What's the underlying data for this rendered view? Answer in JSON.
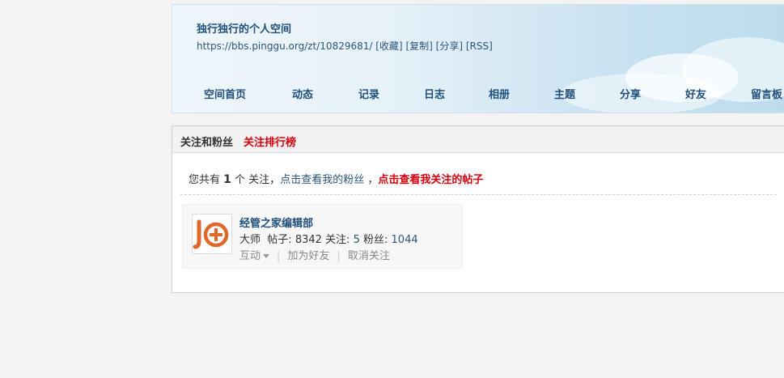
{
  "header": {
    "title": "独行独行的个人空间",
    "url": "https://bbs.pinggu.org/zt/10829681/",
    "links": [
      "[收藏]",
      "[复制]",
      "[分享]",
      "[RSS]"
    ]
  },
  "nav": [
    "空间首页",
    "动态",
    "记录",
    "日志",
    "相册",
    "主题",
    "分享",
    "好友",
    "留言板"
  ],
  "panel": {
    "title": "关注和粉丝",
    "rank_link": "关注排行榜",
    "summary_prefix": "您共有",
    "summary_count": "1",
    "summary_suffix": "个 关注，",
    "fans_link": "点击查看我的粉丝",
    "separator": "，",
    "posts_link": "点击查看我关注的帖子"
  },
  "user": {
    "name": "经管之家编辑部",
    "level": "大师",
    "posts_label": "帖子:",
    "posts": "8342",
    "follow_label": "关注:",
    "follow": "5",
    "fans_label": "粉丝:",
    "fans": "1044",
    "avatar_text": "JG",
    "actions": [
      "互动",
      "加为好友",
      "取消关注"
    ]
  },
  "colors": {
    "accent_red": "#d9000e",
    "link_blue": "#1f4f7a",
    "logo_orange": "#e0672a"
  }
}
